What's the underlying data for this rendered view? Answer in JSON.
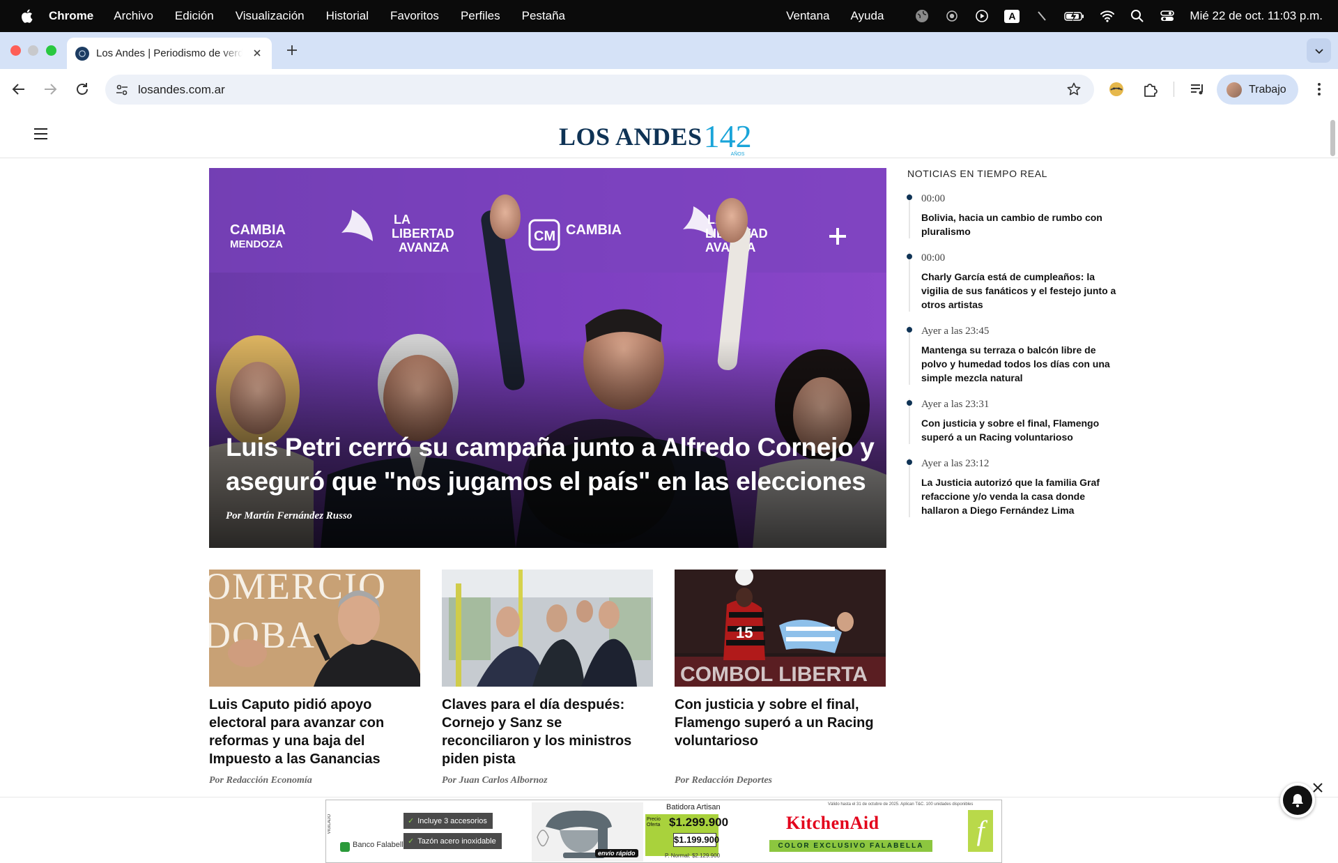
{
  "menubar": {
    "app_name": "Chrome",
    "items": [
      "Archivo",
      "Edición",
      "Visualización",
      "Historial",
      "Favoritos",
      "Perfiles",
      "Pestaña"
    ],
    "right_items": [
      "Ventana",
      "Ayuda"
    ],
    "input_source": "A",
    "clock": "Mié 22 de oct. 11:03 p.m.",
    "status_icons": [
      "globe-icon",
      "eye-icon",
      "play-icon",
      "keyboard-input-icon",
      "slash-icon",
      "battery-charging-icon",
      "wifi-icon",
      "search-icon",
      "control-center-icon"
    ]
  },
  "browser": {
    "tab_title": "Los Andes | Periodismo de verdad",
    "url": "losandes.com.ar",
    "profile_label": "Trabajo"
  },
  "site": {
    "logo_text": "LOS ANDES",
    "logo_number": "142",
    "logo_anos": "AÑOS",
    "brand_color": "#0f3355",
    "accent_color": "#19a4d9"
  },
  "hero": {
    "title": "Luis Petri cerró su campaña junto a Alfredo Cornejo y aseguró que \"nos jugamos el país\" en las elecciones",
    "author": "Por Martín Fernández Russo",
    "backdrop_texts": [
      "CAMBIA MENDOZA",
      "LA LIBERTAD AVANZA",
      "CM"
    ]
  },
  "sidebar": {
    "title": "NOTICIAS EN TIEMPO REAL",
    "items": [
      {
        "time": "00:00",
        "headline": "Bolivia, hacia un cambio de rumbo con pluralismo"
      },
      {
        "time": "00:00",
        "headline": "Charly García está de cumpleaños: la vigilia de sus fanáticos y el festejo junto a otros artistas"
      },
      {
        "time": "Ayer a las 23:45",
        "headline": "Mantenga su terraza o balcón libre de polvo y humedad todos los días con una simple mezcla natural"
      },
      {
        "time": "Ayer a las 23:31",
        "headline": "Con justicia y sobre el final, Flamengo superó a un Racing voluntarioso"
      },
      {
        "time": "Ayer a las 23:12",
        "headline": "La Justicia autorizó que la familia Graf refaccione y/o venda la casa donde hallaron a Diego Fernández Lima"
      }
    ]
  },
  "cards": [
    {
      "title": "Luis Caputo pidió apoyo electoral para avanzar con reformas y una baja del Impuesto a las Ganancias",
      "author": "Por Redacción Economía",
      "photo_text": "OMERCIO DOBA"
    },
    {
      "title": "Claves para el día después: Cornejo y Sanz se reconciliaron y los ministros piden pista",
      "author": "Por Juan Carlos Albornoz"
    },
    {
      "title": "Con justicia y sobre el final, Flamengo superó a un Racing voluntarioso",
      "author": "Por Redacción Deportes",
      "photo_text": "COMBOL LIBERTA",
      "jersey_number": "15"
    }
  ],
  "ad": {
    "features": [
      "Incluye 3 accesorios",
      "Tazón acero inoxidable"
    ],
    "bank": "Banco Falabella",
    "product": "Batidora Artisan",
    "offer_label": "Precio Oferta",
    "offer_price": "$1.299.900",
    "bank_price": "$1.199.900",
    "normal_price": "P. Normal: $2.129.900",
    "shipping_badge": "envío rápido",
    "brand": "KitchenAid",
    "brand_tag": "COLOR EXCLUSIVO FALABELLA",
    "legal": "Válido hasta el 31 de octubre de 2025. Aplican T&C. 100 unidades disponibles",
    "store_logo": "f",
    "side_text": "VIGILADO"
  }
}
